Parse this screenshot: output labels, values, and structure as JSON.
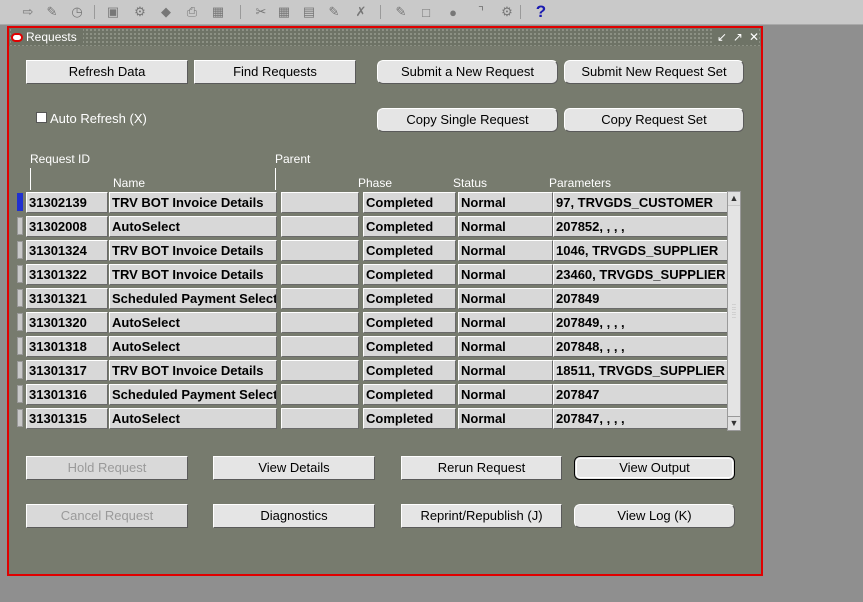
{
  "window": {
    "title": "Requests"
  },
  "toolbar": {
    "icons": [
      "new-record-icon",
      "find-icon",
      "navigator-icon",
      "open-folder-icon",
      "save-icon",
      "switch-responsibility-icon",
      "print-icon",
      "close-form-icon",
      "cut-icon",
      "copy-icon",
      "paste-icon",
      "clear-record-icon",
      "delete-record-icon",
      "edit-field-icon",
      "zoom-icon",
      "translations-icon",
      "attachments-icon",
      "folder-tools-icon",
      "help-icon"
    ],
    "help_glyph": "?"
  },
  "buttons": {
    "refresh_data": "Refresh Data",
    "find_requests": "Find Requests",
    "submit_new_request": "Submit a New Request",
    "submit_new_request_set": "Submit New Request Set",
    "copy_single_request": "Copy Single Request",
    "copy_request_set": "Copy Request Set",
    "hold_request": "Hold Request",
    "view_details": "View Details",
    "rerun_request": "Rerun Request",
    "view_output": "View Output",
    "cancel_request": "Cancel Request",
    "diagnostics": "Diagnostics",
    "reprint_republish": "Reprint/Republish (J)",
    "view_log": "View Log (K)"
  },
  "auto_refresh": {
    "label": "Auto Refresh (X)",
    "checked": false
  },
  "table": {
    "headers": {
      "request_id": "Request ID",
      "parent": "Parent",
      "name": "Name",
      "phase": "Phase",
      "status": "Status",
      "parameters": "Parameters"
    },
    "rows": [
      {
        "id": "31302139",
        "name": "TRV BOT Invoice Details",
        "parent": "",
        "phase": "Completed",
        "status": "Normal",
        "parameters": "97, TRVGDS_CUSTOMER"
      },
      {
        "id": "31302008",
        "name": "AutoSelect",
        "parent": "",
        "phase": "Completed",
        "status": "Normal",
        "parameters": "207852, , , ,"
      },
      {
        "id": "31301324",
        "name": "TRV BOT Invoice Details",
        "parent": "",
        "phase": "Completed",
        "status": "Normal",
        "parameters": "1046, TRVGDS_SUPPLIER"
      },
      {
        "id": "31301322",
        "name": "TRV BOT Invoice Details",
        "parent": "",
        "phase": "Completed",
        "status": "Normal",
        "parameters": "23460, TRVGDS_SUPPLIER"
      },
      {
        "id": "31301321",
        "name": "Scheduled Payment Selection",
        "parent": "",
        "phase": "Completed",
        "status": "Normal",
        "parameters": "207849"
      },
      {
        "id": "31301320",
        "name": "AutoSelect",
        "parent": "",
        "phase": "Completed",
        "status": "Normal",
        "parameters": "207849, , , ,"
      },
      {
        "id": "31301318",
        "name": "AutoSelect",
        "parent": "",
        "phase": "Completed",
        "status": "Normal",
        "parameters": "207848, , , ,"
      },
      {
        "id": "31301317",
        "name": "TRV BOT Invoice Details",
        "parent": "",
        "phase": "Completed",
        "status": "Normal",
        "parameters": "18511, TRVGDS_SUPPLIER"
      },
      {
        "id": "31301316",
        "name": "Scheduled Payment Selection",
        "parent": "",
        "phase": "Completed",
        "status": "Normal",
        "parameters": "207847"
      },
      {
        "id": "31301315",
        "name": "AutoSelect",
        "parent": "",
        "phase": "Completed",
        "status": "Normal",
        "parameters": "207847, , , ,"
      }
    ]
  },
  "colors": {
    "window_border": "#e00000",
    "window_bg": "#777b6e",
    "selected_marker": "#2030d0"
  }
}
